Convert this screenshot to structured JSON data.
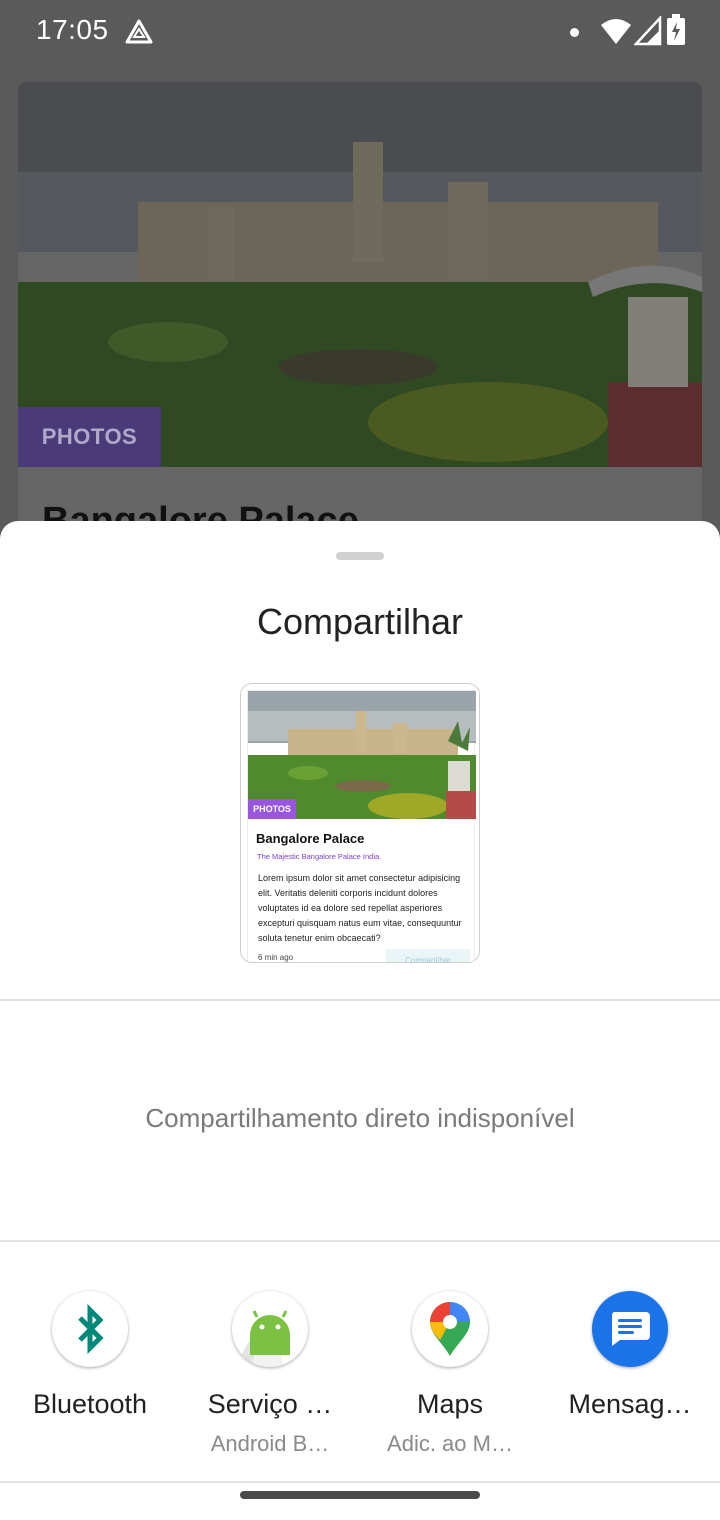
{
  "status_bar": {
    "time": "17:05",
    "icons": [
      "drive-icon",
      "notification-dot",
      "wifi-icon",
      "signal-icon",
      "battery-charging-icon"
    ]
  },
  "background": {
    "tag": "PHOTOS",
    "title": "Bangalore Palace"
  },
  "share_sheet": {
    "title": "Compartilhar",
    "preview": {
      "tag": "PHOTOS",
      "title": "Bangalore Palace",
      "subtitle": "The Majestic Bangalore Palace India.",
      "body": "Lorem ipsum dolor sit amet consectetur adipisicing elit. Veritatis deleniti corporis incidunt dolores voluptates id ea dolore sed repellat asperiores excepturi quisquam natus eum vitae, consequuntur soluta tenetur enim obcaecati?",
      "time": "6 min ago",
      "button": "Compartilhar"
    },
    "direct_share_message": "Compartilhamento direto indisponível",
    "apps": [
      {
        "label": "Bluetooth",
        "sublabel": "",
        "icon": "bluetooth-icon",
        "color": "#00897b"
      },
      {
        "label": "Serviço …",
        "sublabel": "Android B…",
        "icon": "android-icon",
        "color": "#7cc142"
      },
      {
        "label": "Maps",
        "sublabel": "Adic. ao M…",
        "icon": "maps-icon",
        "color": "#34a853"
      },
      {
        "label": "Mensag…",
        "sublabel": "",
        "icon": "messages-icon",
        "color": "#1a73e8"
      }
    ]
  }
}
